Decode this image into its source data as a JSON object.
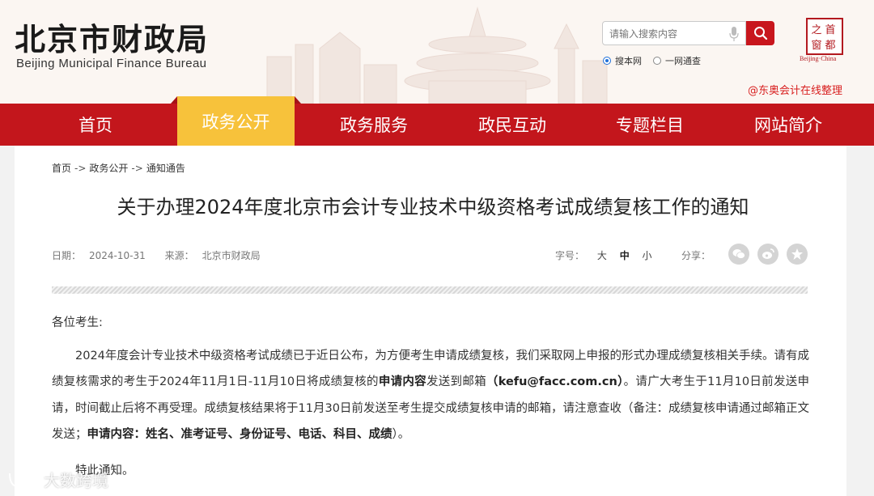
{
  "header": {
    "logo_cn": "北京市财政局",
    "logo_en": "Beijing Municipal Finance Bureau",
    "search_placeholder": "请输入搜索内容",
    "search_scope": [
      {
        "label": "搜本网",
        "checked": true
      },
      {
        "label": "一网通查",
        "checked": false
      }
    ],
    "seal_chars": [
      "首",
      "都",
      "之",
      "窗"
    ],
    "seal_caption": "Beijing·China",
    "watermark": "@东奥会计在线整理"
  },
  "nav": {
    "items": [
      {
        "label": "首页",
        "active": false
      },
      {
        "label": "政务公开",
        "active": true
      },
      {
        "label": "政务服务",
        "active": false
      },
      {
        "label": "政民互动",
        "active": false
      },
      {
        "label": "专题栏目",
        "active": false
      },
      {
        "label": "网站简介",
        "active": false
      }
    ]
  },
  "breadcrumb": [
    "首页",
    "政务公开",
    "通知通告"
  ],
  "breadcrumb_sep": "->",
  "article": {
    "title": "关于办理2024年度北京市会计专业技术中级资格考试成绩复核工作的通知",
    "date_label": "日期：",
    "date": "2024-10-31",
    "source_label": "来源：",
    "source": "北京市财政局",
    "fontsize_label": "字号：",
    "fontsizes": [
      "大",
      "中",
      "小"
    ],
    "share_label": "分享：",
    "share_icons": [
      "wechat-icon",
      "weibo-icon",
      "favorite-icon"
    ],
    "greeting": "各位考生:",
    "p1_a": "2024年度会计专业技术中级资格考试成绩已于近日公布，为方便考生申请成绩复核，我们采取网上申报的形式办理成绩复核相关手续。请有成绩复核需求的考生于2024年11月1日-11月10日将成绩复核的",
    "p1_b": "申请内容",
    "p1_c": "发送到邮箱",
    "p1_d": "（kefu@facc.com.cn）",
    "p1_e": "。请广大考生于11月10日前发送申请，时间截止后将不再受理。成绩复核结果将于11月30日前发送至考生提交成绩复核申请的邮箱，请注意查收（备注：成绩复核申请通过邮箱正文发送；",
    "p1_f": "申请内容：姓名、准考证号、身份证号、电话、科目、成绩",
    "p1_g": "）。",
    "sign": "特此通知。"
  },
  "bottom_watermark": "大数跨境"
}
